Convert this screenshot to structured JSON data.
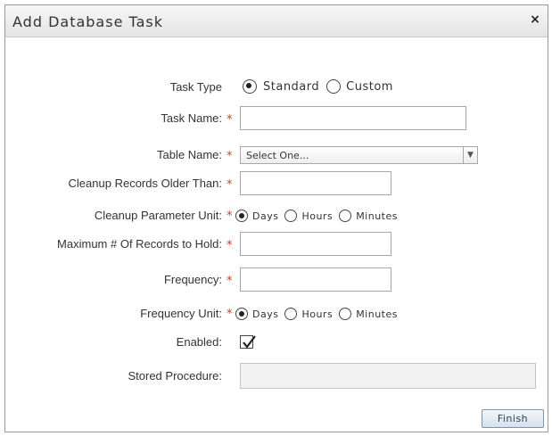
{
  "dialog": {
    "title": "Add Database Task",
    "close_glyph": "×"
  },
  "form": {
    "required_marker": "*",
    "task_type": {
      "label": "Task Type",
      "options": [
        "Standard",
        "Custom"
      ],
      "selected": "Standard"
    },
    "task_name": {
      "label": "Task Name:",
      "value": ""
    },
    "table_name": {
      "label": "Table Name:",
      "selected_text": "Select One...",
      "arrow_glyph": "▼"
    },
    "cleanup_older_than": {
      "label": "Cleanup Records Older Than:",
      "value": ""
    },
    "cleanup_unit": {
      "label": "Cleanup Parameter Unit:",
      "options": [
        "Days",
        "Hours",
        "Minutes"
      ],
      "selected": "Days"
    },
    "max_records": {
      "label": "Maximum # Of Records to Hold:",
      "value": ""
    },
    "frequency": {
      "label": "Frequency:",
      "value": ""
    },
    "frequency_unit": {
      "label": "Frequency Unit:",
      "options": [
        "Days",
        "Hours",
        "Minutes"
      ],
      "selected": "Days"
    },
    "enabled": {
      "label": "Enabled:",
      "checked": true
    },
    "stored_procedure": {
      "label": "Stored Procedure:",
      "value": ""
    }
  },
  "footer": {
    "finish_label": "Finish"
  },
  "icons": {
    "close": "close-icon",
    "checkmark": "checkmark-icon",
    "dropdown": "chevron-down-icon"
  },
  "colors": {
    "required": "#e03030",
    "button_border": "#7f93aa",
    "title_bar": "#ececec"
  }
}
